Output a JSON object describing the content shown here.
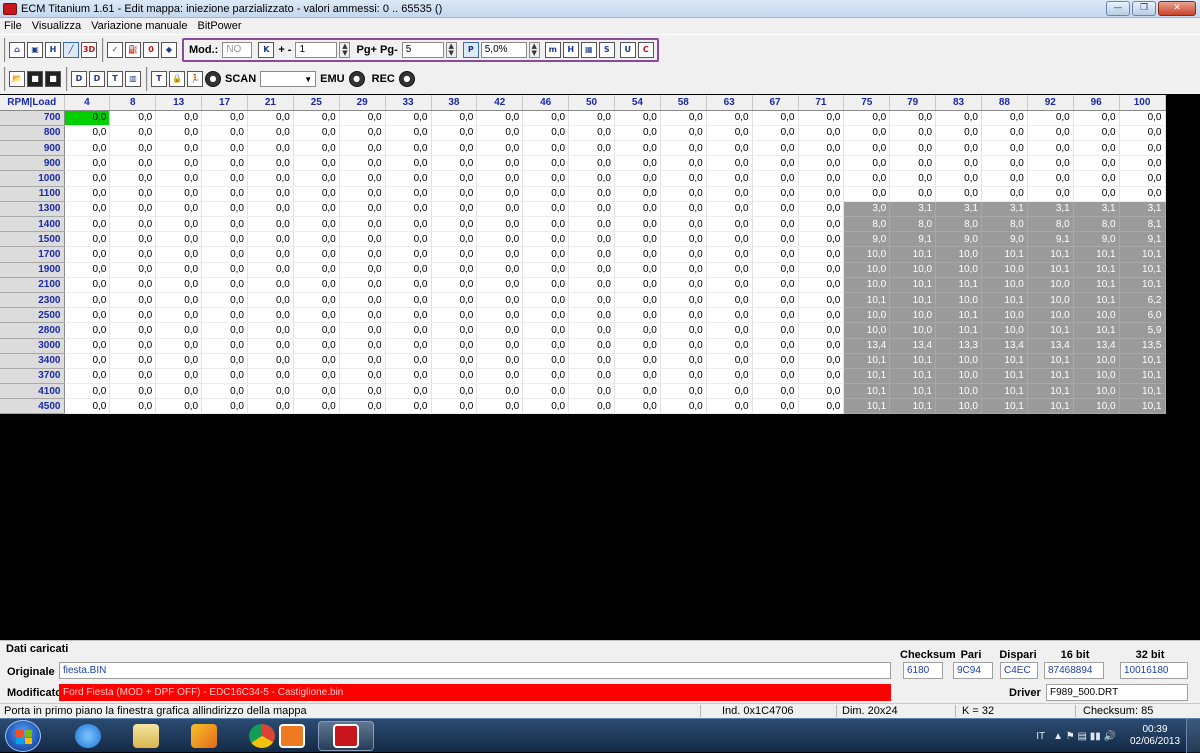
{
  "window": {
    "title": "ECM Titanium 1.61 - Edit mappa: iniezione parzializzato - valori ammessi: 0 .. 65535 ()",
    "minimize": "—",
    "maximize": "❐",
    "close": "✕"
  },
  "menu": [
    "File",
    "Visualizza",
    "Variazione manuale",
    "BitPower"
  ],
  "toolbar": {
    "mod_label": "Mod.:",
    "mod_value": "NO",
    "k_label": "K",
    "plusminus_label": "+ -",
    "plusminus_value": "1",
    "pg_label": "Pg+ Pg-",
    "pg_value": "5",
    "p_label": "P",
    "percent_value": "5,0%",
    "scan_label": "SCAN",
    "scan_value": "",
    "emu_label": "EMU",
    "rec_label": "REC",
    "icons_row1": [
      "home-icon",
      "windows-icon",
      "h-icon",
      "graph-icon",
      "3d-icon",
      "checkmark-icon",
      "fuel-icon",
      "zero-icon",
      "color-icon"
    ],
    "icons_row2": [
      "open-folder-icon",
      "save-icon",
      "save-as-icon",
      "d1-icon",
      "d2-icon",
      "d3-icon",
      "d4-icon",
      "t-icon",
      "lock-icon",
      "runner-icon",
      "record-dot-icon"
    ]
  },
  "grid": {
    "corner": "RPM|Load",
    "columns": [
      "4",
      "8",
      "13",
      "17",
      "21",
      "25",
      "29",
      "33",
      "38",
      "42",
      "46",
      "50",
      "54",
      "58",
      "63",
      "67",
      "71",
      "75",
      "79",
      "83",
      "88",
      "92",
      "96",
      "100"
    ],
    "rows": [
      {
        "rpm": "700",
        "values": [
          "0,0",
          "0,0",
          "0,0",
          "0,0",
          "0,0",
          "0,0",
          "0,0",
          "0,0",
          "0,0",
          "0,0",
          "0,0",
          "0,0",
          "0,0",
          "0,0",
          "0,0",
          "0,0",
          "0,0",
          "0,0",
          "0,0",
          "0,0",
          "0,0",
          "0,0",
          "0,0",
          "0,0"
        ]
      },
      {
        "rpm": "800",
        "values": [
          "0,0",
          "0,0",
          "0,0",
          "0,0",
          "0,0",
          "0,0",
          "0,0",
          "0,0",
          "0,0",
          "0,0",
          "0,0",
          "0,0",
          "0,0",
          "0,0",
          "0,0",
          "0,0",
          "0,0",
          "0,0",
          "0,0",
          "0,0",
          "0,0",
          "0,0",
          "0,0",
          "0,0"
        ]
      },
      {
        "rpm": "900",
        "values": [
          "0,0",
          "0,0",
          "0,0",
          "0,0",
          "0,0",
          "0,0",
          "0,0",
          "0,0",
          "0,0",
          "0,0",
          "0,0",
          "0,0",
          "0,0",
          "0,0",
          "0,0",
          "0,0",
          "0,0",
          "0,0",
          "0,0",
          "0,0",
          "0,0",
          "0,0",
          "0,0",
          "0,0"
        ]
      },
      {
        "rpm": "900",
        "values": [
          "0,0",
          "0,0",
          "0,0",
          "0,0",
          "0,0",
          "0,0",
          "0,0",
          "0,0",
          "0,0",
          "0,0",
          "0,0",
          "0,0",
          "0,0",
          "0,0",
          "0,0",
          "0,0",
          "0,0",
          "0,0",
          "0,0",
          "0,0",
          "0,0",
          "0,0",
          "0,0",
          "0,0"
        ]
      },
      {
        "rpm": "1000",
        "values": [
          "0,0",
          "0,0",
          "0,0",
          "0,0",
          "0,0",
          "0,0",
          "0,0",
          "0,0",
          "0,0",
          "0,0",
          "0,0",
          "0,0",
          "0,0",
          "0,0",
          "0,0",
          "0,0",
          "0,0",
          "0,0",
          "0,0",
          "0,0",
          "0,0",
          "0,0",
          "0,0",
          "0,0"
        ]
      },
      {
        "rpm": "1100",
        "values": [
          "0,0",
          "0,0",
          "0,0",
          "0,0",
          "0,0",
          "0,0",
          "0,0",
          "0,0",
          "0,0",
          "0,0",
          "0,0",
          "0,0",
          "0,0",
          "0,0",
          "0,0",
          "0,0",
          "0,0",
          "0,0",
          "0,0",
          "0,0",
          "0,0",
          "0,0",
          "0,0",
          "0,0"
        ]
      },
      {
        "rpm": "1300",
        "values": [
          "0,0",
          "0,0",
          "0,0",
          "0,0",
          "0,0",
          "0,0",
          "0,0",
          "0,0",
          "0,0",
          "0,0",
          "0,0",
          "0,0",
          "0,0",
          "0,0",
          "0,0",
          "0,0",
          "0,0",
          "3,0",
          "3,1",
          "3,1",
          "3,1",
          "3,1",
          "3,1",
          "3,1"
        ]
      },
      {
        "rpm": "1400",
        "values": [
          "0,0",
          "0,0",
          "0,0",
          "0,0",
          "0,0",
          "0,0",
          "0,0",
          "0,0",
          "0,0",
          "0,0",
          "0,0",
          "0,0",
          "0,0",
          "0,0",
          "0,0",
          "0,0",
          "0,0",
          "8,0",
          "8,0",
          "8,0",
          "8,0",
          "8,0",
          "8,0",
          "8,1"
        ]
      },
      {
        "rpm": "1500",
        "values": [
          "0,0",
          "0,0",
          "0,0",
          "0,0",
          "0,0",
          "0,0",
          "0,0",
          "0,0",
          "0,0",
          "0,0",
          "0,0",
          "0,0",
          "0,0",
          "0,0",
          "0,0",
          "0,0",
          "0,0",
          "9,0",
          "9,1",
          "9,0",
          "9,0",
          "9,1",
          "9,0",
          "9,1"
        ]
      },
      {
        "rpm": "1700",
        "values": [
          "0,0",
          "0,0",
          "0,0",
          "0,0",
          "0,0",
          "0,0",
          "0,0",
          "0,0",
          "0,0",
          "0,0",
          "0,0",
          "0,0",
          "0,0",
          "0,0",
          "0,0",
          "0,0",
          "0,0",
          "10,0",
          "10,1",
          "10,0",
          "10,1",
          "10,1",
          "10,1",
          "10,1"
        ]
      },
      {
        "rpm": "1900",
        "values": [
          "0,0",
          "0,0",
          "0,0",
          "0,0",
          "0,0",
          "0,0",
          "0,0",
          "0,0",
          "0,0",
          "0,0",
          "0,0",
          "0,0",
          "0,0",
          "0,0",
          "0,0",
          "0,0",
          "0,0",
          "10,0",
          "10,0",
          "10,0",
          "10,0",
          "10,1",
          "10,1",
          "10,1"
        ]
      },
      {
        "rpm": "2100",
        "values": [
          "0,0",
          "0,0",
          "0,0",
          "0,0",
          "0,0",
          "0,0",
          "0,0",
          "0,0",
          "0,0",
          "0,0",
          "0,0",
          "0,0",
          "0,0",
          "0,0",
          "0,0",
          "0,0",
          "0,0",
          "10,0",
          "10,1",
          "10,1",
          "10,0",
          "10,0",
          "10,1",
          "10,1"
        ]
      },
      {
        "rpm": "2300",
        "values": [
          "0,0",
          "0,0",
          "0,0",
          "0,0",
          "0,0",
          "0,0",
          "0,0",
          "0,0",
          "0,0",
          "0,0",
          "0,0",
          "0,0",
          "0,0",
          "0,0",
          "0,0",
          "0,0",
          "0,0",
          "10,1",
          "10,1",
          "10,0",
          "10,1",
          "10,0",
          "10,1",
          "6,2"
        ]
      },
      {
        "rpm": "2500",
        "values": [
          "0,0",
          "0,0",
          "0,0",
          "0,0",
          "0,0",
          "0,0",
          "0,0",
          "0,0",
          "0,0",
          "0,0",
          "0,0",
          "0,0",
          "0,0",
          "0,0",
          "0,0",
          "0,0",
          "0,0",
          "10,0",
          "10,0",
          "10,1",
          "10,0",
          "10,0",
          "10,0",
          "6,0"
        ]
      },
      {
        "rpm": "2800",
        "values": [
          "0,0",
          "0,0",
          "0,0",
          "0,0",
          "0,0",
          "0,0",
          "0,0",
          "0,0",
          "0,0",
          "0,0",
          "0,0",
          "0,0",
          "0,0",
          "0,0",
          "0,0",
          "0,0",
          "0,0",
          "10,0",
          "10,0",
          "10,1",
          "10,0",
          "10,1",
          "10,1",
          "5,9"
        ]
      },
      {
        "rpm": "3000",
        "values": [
          "0,0",
          "0,0",
          "0,0",
          "0,0",
          "0,0",
          "0,0",
          "0,0",
          "0,0",
          "0,0",
          "0,0",
          "0,0",
          "0,0",
          "0,0",
          "0,0",
          "0,0",
          "0,0",
          "0,0",
          "13,4",
          "13,4",
          "13,3",
          "13,4",
          "13,4",
          "13,4",
          "13,5"
        ]
      },
      {
        "rpm": "3400",
        "values": [
          "0,0",
          "0,0",
          "0,0",
          "0,0",
          "0,0",
          "0,0",
          "0,0",
          "0,0",
          "0,0",
          "0,0",
          "0,0",
          "0,0",
          "0,0",
          "0,0",
          "0,0",
          "0,0",
          "0,0",
          "10,1",
          "10,1",
          "10,0",
          "10,1",
          "10,1",
          "10,0",
          "10,1"
        ]
      },
      {
        "rpm": "3700",
        "values": [
          "0,0",
          "0,0",
          "0,0",
          "0,0",
          "0,0",
          "0,0",
          "0,0",
          "0,0",
          "0,0",
          "0,0",
          "0,0",
          "0,0",
          "0,0",
          "0,0",
          "0,0",
          "0,0",
          "0,0",
          "10,1",
          "10,1",
          "10,0",
          "10,1",
          "10,1",
          "10,0",
          "10,1"
        ]
      },
      {
        "rpm": "4100",
        "values": [
          "0,0",
          "0,0",
          "0,0",
          "0,0",
          "0,0",
          "0,0",
          "0,0",
          "0,0",
          "0,0",
          "0,0",
          "0,0",
          "0,0",
          "0,0",
          "0,0",
          "0,0",
          "0,0",
          "0,0",
          "10,1",
          "10,1",
          "10,0",
          "10,1",
          "10,1",
          "10,0",
          "10,1"
        ]
      },
      {
        "rpm": "4500",
        "values": [
          "0,0",
          "0,0",
          "0,0",
          "0,0",
          "0,0",
          "0,0",
          "0,0",
          "0,0",
          "0,0",
          "0,0",
          "0,0",
          "0,0",
          "0,0",
          "0,0",
          "0,0",
          "0,0",
          "0,0",
          "10,1",
          "10,1",
          "10,0",
          "10,1",
          "10,1",
          "10,0",
          "10,1"
        ]
      }
    ],
    "modified_from_column": 17,
    "selected_cell": {
      "row": 0,
      "col": 0
    },
    "colors": {
      "selected": "#00d000",
      "modified": "#9a9a9a",
      "header_text": "#1a2aa8"
    }
  },
  "data_panel": {
    "title": "Dati caricati",
    "originale_label": "Originale",
    "originale_value": "fiesta.BIN",
    "modificato_label": "Modificato",
    "modificato_value": "Ford Fiesta (MOD + DPF OFF) - EDC16C34-5 - Castiglione.bin",
    "checksum_label": "Checksum",
    "checksum_value": "6180",
    "pari_label": "Pari",
    "pari_value": "9C94",
    "dispari_label": "Dispari",
    "dispari_value": "C4EC",
    "bit16_label": "16 bit",
    "bit16_value": "87468894",
    "bit32_label": "32 bit",
    "bit32_value": "10016180",
    "driver_label": "Driver",
    "driver_value": "F989_500.DRT"
  },
  "status": {
    "message": "Porta in primo piano la finestra grafica allindirizzo della mappa",
    "ind": "Ind. 0x1C4706",
    "dim": "Dim. 20x24",
    "k": "K = 32",
    "checksum": "Checksum: 85"
  },
  "taskbar": {
    "items": [
      "internet-explorer",
      "file-explorer",
      "media-center",
      "chrome",
      "app-orange",
      "ecm-titanium"
    ],
    "language": "IT",
    "time": "00:39",
    "date": "02/06/2013"
  }
}
